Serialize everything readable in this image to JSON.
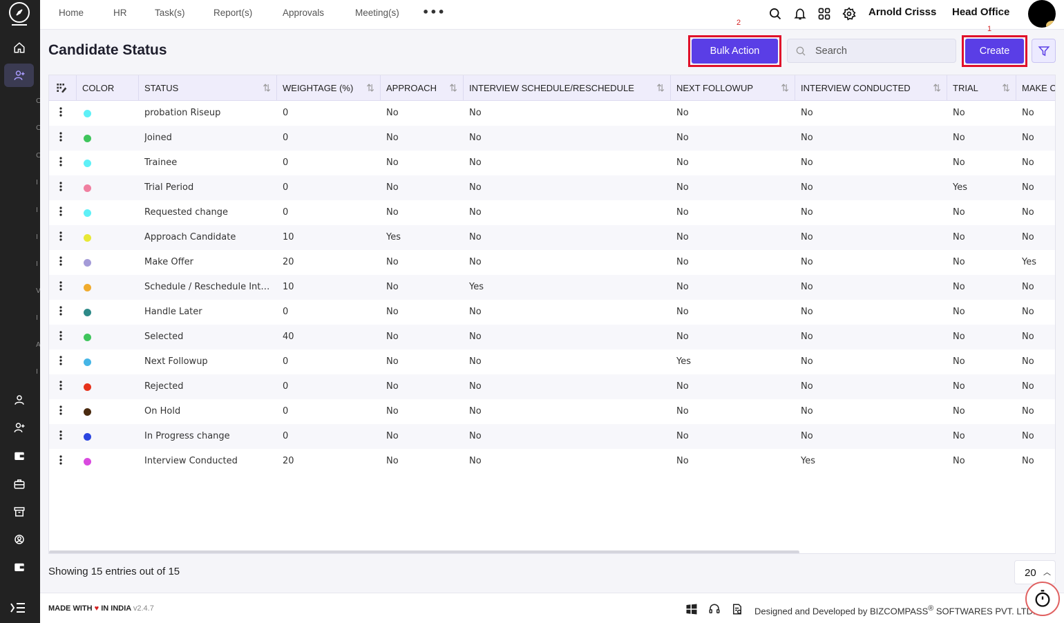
{
  "nav": {
    "items": [
      "Home",
      "HR",
      "Task(s)",
      "Report(s)",
      "Approvals",
      "Meeting(s)"
    ],
    "more_label": "•••"
  },
  "user": {
    "name": "Arnold Crisss",
    "office": "Head Office"
  },
  "page": {
    "title": "Candidate Status",
    "bulk_action_label": "Bulk Action",
    "create_label": "Create",
    "search_placeholder": "Search",
    "annotation_1": "1",
    "annotation_2": "2"
  },
  "table": {
    "columns": [
      "COLOR",
      "STATUS",
      "WEIGHTAGE (%)",
      "APPROACH",
      "INTERVIEW SCHEDULE/RESCHEDULE",
      "NEXT FOLLOWUP",
      "INTERVIEW CONDUCTED",
      "TRIAL",
      "MAKE OFFER"
    ],
    "rows": [
      {
        "color": "#5ef0f7",
        "status": "probation Riseup",
        "weightage": "0",
        "approach": "No",
        "interview_schedule": "No",
        "next_followup": "No",
        "interview_conducted": "No",
        "trial": "No",
        "make_offer": "No"
      },
      {
        "color": "#3fc55c",
        "status": "Joined",
        "weightage": "0",
        "approach": "No",
        "interview_schedule": "No",
        "next_followup": "No",
        "interview_conducted": "No",
        "trial": "No",
        "make_offer": "No"
      },
      {
        "color": "#5ef0f7",
        "status": "Trainee",
        "weightage": "0",
        "approach": "No",
        "interview_schedule": "No",
        "next_followup": "No",
        "interview_conducted": "No",
        "trial": "No",
        "make_offer": "No"
      },
      {
        "color": "#f07fa0",
        "status": "Trial Period",
        "weightage": "0",
        "approach": "No",
        "interview_schedule": "No",
        "next_followup": "No",
        "interview_conducted": "No",
        "trial": "Yes",
        "make_offer": "No"
      },
      {
        "color": "#5ef0f7",
        "status": "Requested change",
        "weightage": "0",
        "approach": "No",
        "interview_schedule": "No",
        "next_followup": "No",
        "interview_conducted": "No",
        "trial": "No",
        "make_offer": "No"
      },
      {
        "color": "#e8e836",
        "status": "Approach Candidate",
        "weightage": "10",
        "approach": "Yes",
        "interview_schedule": "No",
        "next_followup": "No",
        "interview_conducted": "No",
        "trial": "No",
        "make_offer": "No"
      },
      {
        "color": "#a49bd8",
        "status": "Make Offer",
        "weightage": "20",
        "approach": "No",
        "interview_schedule": "No",
        "next_followup": "No",
        "interview_conducted": "No",
        "trial": "No",
        "make_offer": "Yes"
      },
      {
        "color": "#f0ab2e",
        "status": "Schedule / Reschedule Interview",
        "weightage": "10",
        "approach": "No",
        "interview_schedule": "Yes",
        "next_followup": "No",
        "interview_conducted": "No",
        "trial": "No",
        "make_offer": "No"
      },
      {
        "color": "#2e8a88",
        "status": "Handle Later",
        "weightage": "0",
        "approach": "No",
        "interview_schedule": "No",
        "next_followup": "No",
        "interview_conducted": "No",
        "trial": "No",
        "make_offer": "No"
      },
      {
        "color": "#3fc55c",
        "status": "Selected",
        "weightage": "40",
        "approach": "No",
        "interview_schedule": "No",
        "next_followup": "No",
        "interview_conducted": "No",
        "trial": "No",
        "make_offer": "No"
      },
      {
        "color": "#45b5e6",
        "status": "Next Followup",
        "weightage": "0",
        "approach": "No",
        "interview_schedule": "No",
        "next_followup": "Yes",
        "interview_conducted": "No",
        "trial": "No",
        "make_offer": "No"
      },
      {
        "color": "#e6331c",
        "status": "Rejected",
        "weightage": "0",
        "approach": "No",
        "interview_schedule": "No",
        "next_followup": "No",
        "interview_conducted": "No",
        "trial": "No",
        "make_offer": "No"
      },
      {
        "color": "#4a2a10",
        "status": "On Hold",
        "weightage": "0",
        "approach": "No",
        "interview_schedule": "No",
        "next_followup": "No",
        "interview_conducted": "No",
        "trial": "No",
        "make_offer": "No"
      },
      {
        "color": "#2b45e0",
        "status": "In Progress change",
        "weightage": "0",
        "approach": "No",
        "interview_schedule": "No",
        "next_followup": "No",
        "interview_conducted": "No",
        "trial": "No",
        "make_offer": "No"
      },
      {
        "color": "#d94adf",
        "status": "Interview Conducted",
        "weightage": "20",
        "approach": "No",
        "interview_schedule": "No",
        "next_followup": "No",
        "interview_conducted": "Yes",
        "trial": "No",
        "make_offer": "No"
      }
    ]
  },
  "pagination": {
    "showing_text": "Showing 15 entries out of 15",
    "page_size": "20"
  },
  "footer": {
    "made_prefix": "MADE WITH",
    "made_suffix": "IN INDIA",
    "version": "v2.4.7",
    "designed_by": "Designed and Developed by",
    "company": "BIZCOMPASS",
    "company_suffix": "SOFTWARES PVT. LTD."
  },
  "colors": {
    "primary": "#5a3ee6",
    "annotation": "#e0102a",
    "sidebar": "#222222"
  }
}
